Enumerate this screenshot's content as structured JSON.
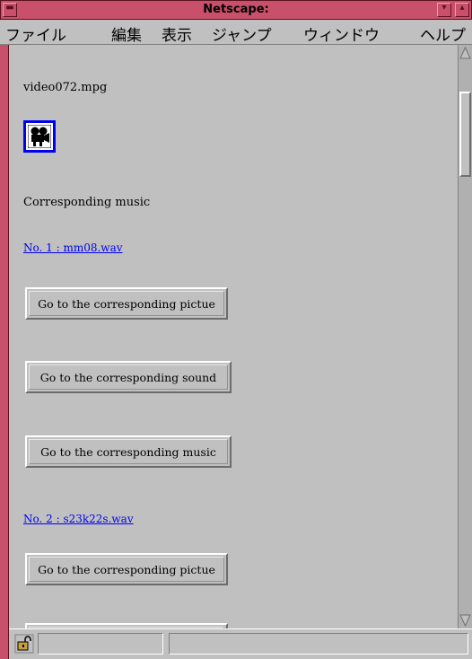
{
  "window": {
    "title": "Netscape:"
  },
  "menu": [
    "ファイル",
    "編集",
    "表示",
    "ジャンプ",
    "ウィンドウ",
    "ヘルプ"
  ],
  "content": {
    "filename": "video072.mpg",
    "heading": "Corresponding music",
    "links": [
      "No. 1 : mm08.wav",
      "No. 2 : s23k22s.wav"
    ],
    "buttons": [
      "Go to the corresponding pictue",
      "Go to the corresponding sound",
      "Go to the corresponding music",
      "Go to the corresponding pictue"
    ]
  },
  "icons": {
    "media": "movie-camera-icon",
    "security": "unlocked-padlock-icon"
  },
  "colors": {
    "frame": "#c8506a",
    "link": "#0000ee",
    "background": "#c0c0c0"
  }
}
